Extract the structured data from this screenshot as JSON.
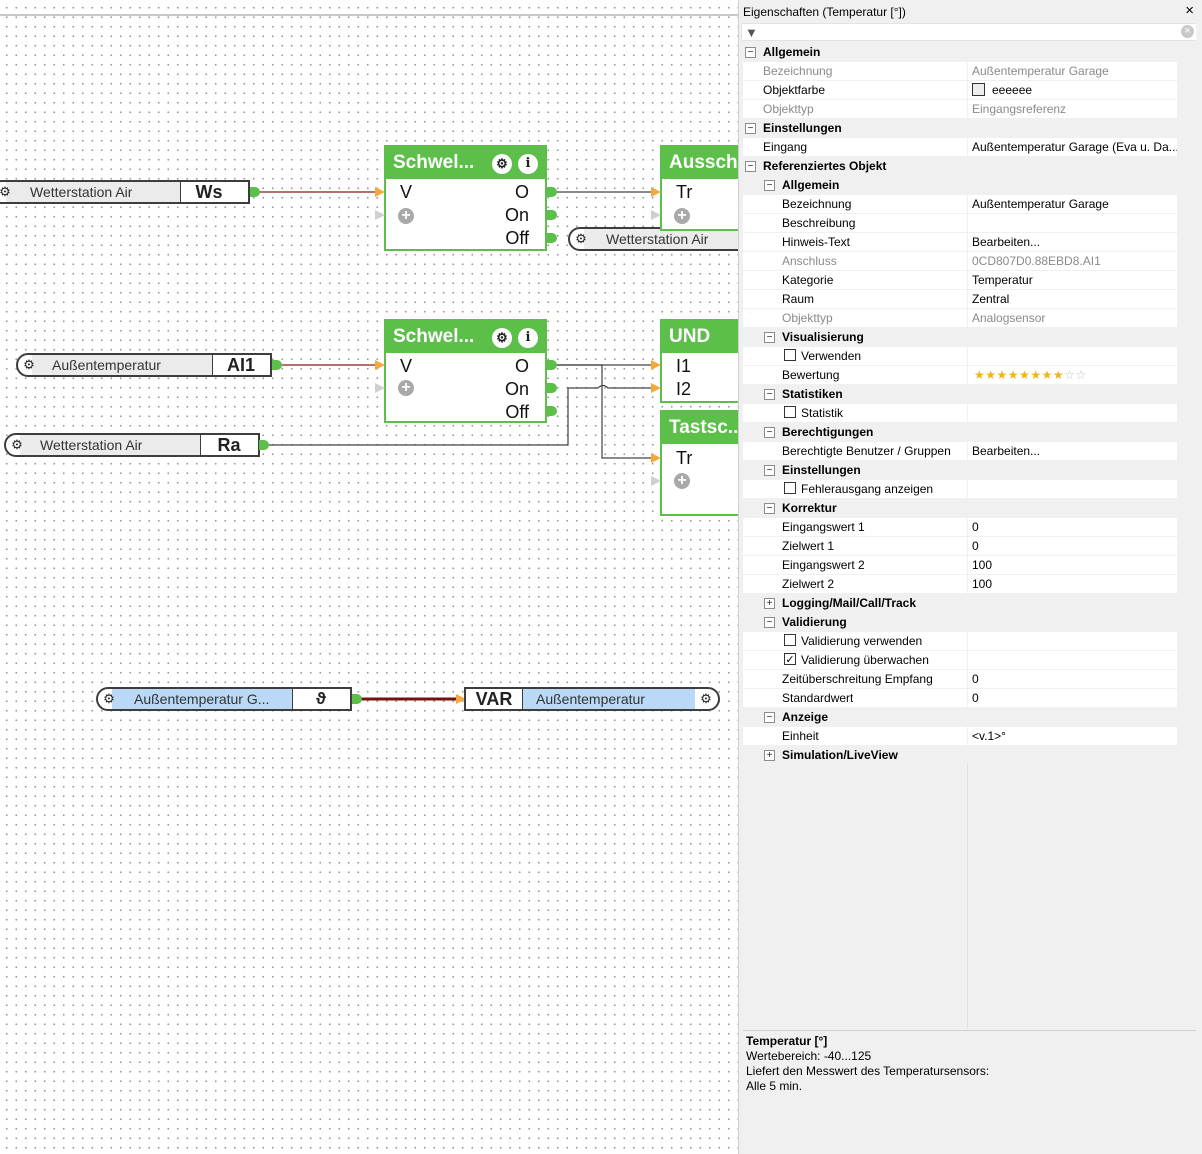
{
  "canvas": {
    "nodes": {
      "ws_input": {
        "label": "Wetterstation Air",
        "code": "Ws"
      },
      "ai1_input": {
        "label": "Außentemperatur",
        "code": "AI1"
      },
      "ra_input": {
        "label": "Wetterstation Air",
        "code": "Ra"
      },
      "wetterstation_out": {
        "label": "Wetterstation Air"
      },
      "garage_input": {
        "label": "Außentemperatur  G...",
        "symbol": "ϑ"
      },
      "var_output": {
        "code": "VAR",
        "label": "Außentemperatur"
      }
    },
    "blocks": {
      "schwell1": {
        "title": "Schwel...",
        "inputs": [
          "V"
        ],
        "outputs": [
          "O",
          "On",
          "Off"
        ]
      },
      "ausschalt": {
        "title": "Aussch",
        "inputs": [
          "Tr"
        ]
      },
      "schwell2": {
        "title": "Schwel...",
        "inputs": [
          "V"
        ],
        "outputs": [
          "O",
          "On",
          "Off"
        ]
      },
      "und": {
        "title": "UND",
        "inputs": [
          "I1",
          "I2"
        ]
      },
      "tastsc": {
        "title": "Tastsc...",
        "inputs": [
          "Tr"
        ]
      }
    },
    "colors": {
      "block_green": "#5cbf4a",
      "port_orange": "#f3a93c",
      "wire_red": "#8b1a1a",
      "selected_blue": "#b9d9f7"
    }
  },
  "panel": {
    "title": "Eigenschaften (Temperatur [°])",
    "close": "×",
    "rows": [
      {
        "type": "cat",
        "level": 0,
        "exp": "⊟",
        "label": "Allgemein"
      },
      {
        "type": "prop",
        "level": 0,
        "name": "Bezeichnung",
        "value": "Außentemperatur Garage",
        "dim": true
      },
      {
        "type": "prop",
        "level": 0,
        "name": "Objektfarbe",
        "value": "eeeeee",
        "swatch": "#eeeeee"
      },
      {
        "type": "prop",
        "level": 0,
        "name": "Objekttyp",
        "value": "Eingangsreferenz",
        "dim": true
      },
      {
        "type": "cat",
        "level": 0,
        "exp": "⊟",
        "label": "Einstellungen"
      },
      {
        "type": "prop",
        "level": 0,
        "name": "Eingang",
        "value": "Außentemperatur Garage (Eva u. Da..."
      },
      {
        "type": "cat",
        "level": 0,
        "exp": "⊟",
        "label": "Referenziertes Objekt"
      },
      {
        "type": "cat",
        "level": 1,
        "exp": "⊟",
        "label": "Allgemein"
      },
      {
        "type": "prop",
        "level": 1,
        "name": "Bezeichnung",
        "value": "Außentemperatur Garage"
      },
      {
        "type": "prop",
        "level": 1,
        "name": "Beschreibung",
        "value": ""
      },
      {
        "type": "prop",
        "level": 1,
        "name": "Hinweis-Text",
        "value": "Bearbeiten..."
      },
      {
        "type": "prop",
        "level": 1,
        "name": "Anschluss",
        "value": "0CD807D0.88EBD8.AI1",
        "dim": true
      },
      {
        "type": "prop",
        "level": 1,
        "name": "Kategorie",
        "value": "Temperatur"
      },
      {
        "type": "prop",
        "level": 1,
        "name": "Raum",
        "value": "Zentral"
      },
      {
        "type": "prop",
        "level": 1,
        "name": "Objekttyp",
        "value": "Analogsensor",
        "dim": true
      },
      {
        "type": "cat",
        "level": 1,
        "exp": "⊟",
        "label": "Visualisierung"
      },
      {
        "type": "prop",
        "level": 1,
        "name": "Verwenden",
        "value": "",
        "checkbox": false
      },
      {
        "type": "prop",
        "level": 1,
        "name": "Bewertung",
        "value": "",
        "rating": 8,
        "rating_max": 10
      },
      {
        "type": "cat",
        "level": 1,
        "exp": "⊟",
        "label": "Statistiken"
      },
      {
        "type": "prop",
        "level": 1,
        "name": "Statistik",
        "value": "",
        "checkbox": false
      },
      {
        "type": "cat",
        "level": 1,
        "exp": "⊟",
        "label": "Berechtigungen"
      },
      {
        "type": "prop",
        "level": 1,
        "name": "Berechtigte Benutzer / Gruppen",
        "value": "Bearbeiten..."
      },
      {
        "type": "cat",
        "level": 1,
        "exp": "⊟",
        "label": "Einstellungen"
      },
      {
        "type": "prop",
        "level": 1,
        "name": "Fehlerausgang anzeigen",
        "value": "",
        "checkbox": false
      },
      {
        "type": "cat",
        "level": 1,
        "exp": "⊟",
        "label": "Korrektur"
      },
      {
        "type": "prop",
        "level": 1,
        "name": "Eingangswert 1",
        "value": "0"
      },
      {
        "type": "prop",
        "level": 1,
        "name": "Zielwert 1",
        "value": "0"
      },
      {
        "type": "prop",
        "level": 1,
        "name": "Eingangswert 2",
        "value": "100"
      },
      {
        "type": "prop",
        "level": 1,
        "name": "Zielwert 2",
        "value": "100"
      },
      {
        "type": "cat",
        "level": 1,
        "exp": "⊞",
        "label": "Logging/Mail/Call/Track"
      },
      {
        "type": "cat",
        "level": 1,
        "exp": "⊟",
        "label": "Validierung"
      },
      {
        "type": "prop",
        "level": 1,
        "name": "Validierung verwenden",
        "value": "",
        "checkbox": false
      },
      {
        "type": "prop",
        "level": 1,
        "name": "Validierung überwachen",
        "value": "",
        "checkbox": true
      },
      {
        "type": "prop",
        "level": 1,
        "name": "Zeitüberschreitung Empfang",
        "value": "0"
      },
      {
        "type": "prop",
        "level": 1,
        "name": "Standardwert",
        "value": "0"
      },
      {
        "type": "cat",
        "level": 1,
        "exp": "⊟",
        "label": "Anzeige"
      },
      {
        "type": "prop",
        "level": 1,
        "name": "Einheit",
        "value": "<v.1>°"
      },
      {
        "type": "cat",
        "level": 1,
        "exp": "⊞",
        "label": "Simulation/LiveView"
      }
    ],
    "description": {
      "title": "Temperatur [°]",
      "lines": [
        "Wertebereich: -40...125",
        "Liefert den Messwert des Temperatursensors:",
        "Alle 5 min."
      ]
    }
  }
}
